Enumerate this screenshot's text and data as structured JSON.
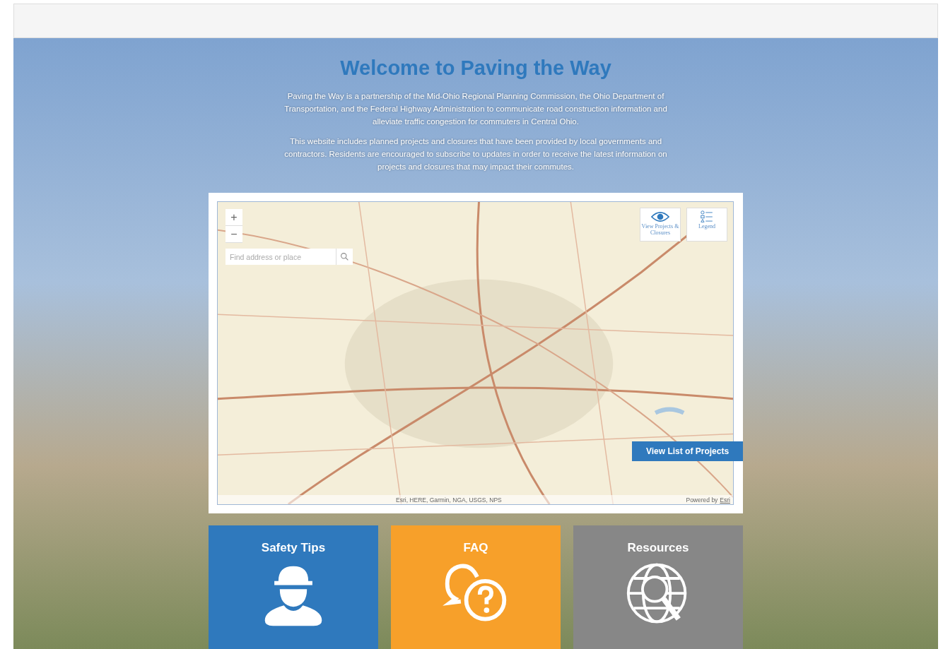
{
  "hero": {
    "title": "Welcome to Paving the Way",
    "paragraphs": [
      "Paving the Way is a partnership of the Mid-Ohio Regional Planning Commission, the Ohio Department of Transportation, and the Federal Highway Administration to communicate road construction information and alleviate traffic congestion for commuters in Central Ohio.",
      "This website includes planned projects and closures that have been provided by local governments and contractors. Residents are encouraged to subscribe to updates in order to receive the latest information on projects and closures that may impact their commutes."
    ]
  },
  "map": {
    "zoom_in": "+",
    "zoom_out": "−",
    "search": {
      "placeholder": "Find address or place"
    },
    "tools": [
      {
        "kind": "eye",
        "label": "View Projects & Closures"
      },
      {
        "kind": "legend",
        "label": "Legend"
      }
    ],
    "list_button": "View List of Projects",
    "attribution": "Esri, HERE, Garmin, NGA, USGS, NPS",
    "powered_by": "Powered by",
    "powered_link": "Esri"
  },
  "tiles": [
    {
      "kind": "worker",
      "title": "Safety Tips",
      "color": "#2f79bd"
    },
    {
      "kind": "faq",
      "title": "FAQ",
      "color": "#f7a02a"
    },
    {
      "kind": "globe",
      "title": "Resources",
      "color": "#878787"
    }
  ]
}
